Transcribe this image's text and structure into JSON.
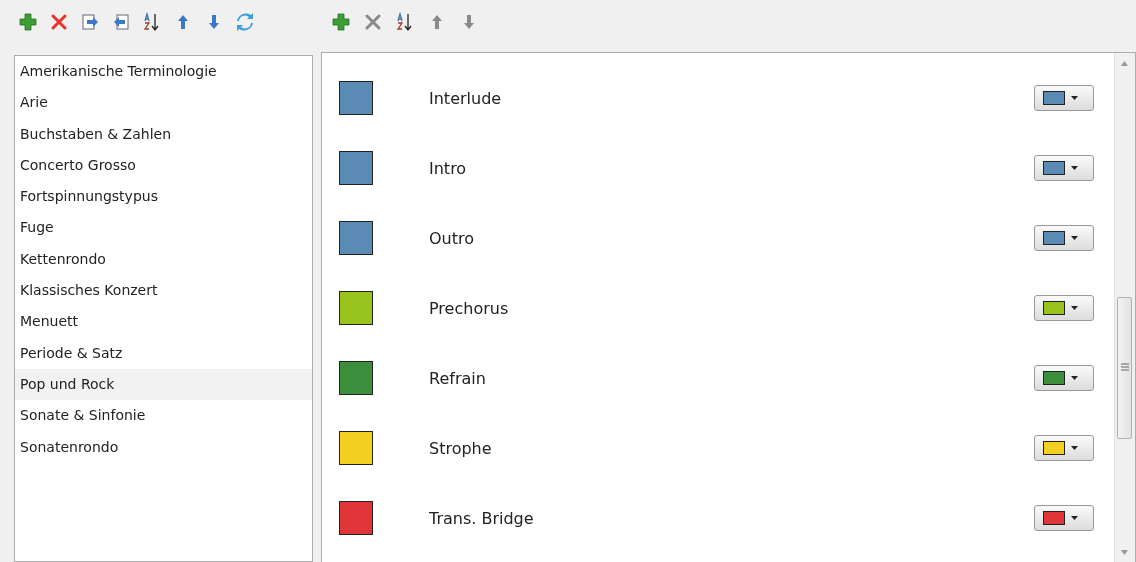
{
  "left_toolbar": [
    {
      "kind": "add",
      "disabled": false
    },
    {
      "kind": "delete",
      "disabled": false
    },
    {
      "kind": "export",
      "disabled": false
    },
    {
      "kind": "import",
      "disabled": false
    },
    {
      "kind": "sort",
      "disabled": false
    },
    {
      "kind": "up",
      "disabled": false
    },
    {
      "kind": "down",
      "disabled": false
    },
    {
      "kind": "refresh",
      "disabled": false
    }
  ],
  "right_toolbar": [
    {
      "kind": "add",
      "disabled": false
    },
    {
      "kind": "delete",
      "disabled": true
    },
    {
      "kind": "sort",
      "disabled": false
    },
    {
      "kind": "up",
      "disabled": true
    },
    {
      "kind": "down",
      "disabled": true
    }
  ],
  "templates": [
    {
      "label": "Amerikanische Terminologie",
      "selected": false
    },
    {
      "label": "Arie",
      "selected": false
    },
    {
      "label": "Buchstaben & Zahlen",
      "selected": false
    },
    {
      "label": "Concerto Grosso",
      "selected": false
    },
    {
      "label": "Fortspinnungstypus",
      "selected": false
    },
    {
      "label": "Fuge",
      "selected": false
    },
    {
      "label": "Kettenrondo",
      "selected": false
    },
    {
      "label": "Klassisches Konzert",
      "selected": false
    },
    {
      "label": "Menuett",
      "selected": false
    },
    {
      "label": "Periode & Satz",
      "selected": false
    },
    {
      "label": "Pop und Rock",
      "selected": true
    },
    {
      "label": "Sonate & Sinfonie",
      "selected": false
    },
    {
      "label": "Sonatenrondo",
      "selected": false
    }
  ],
  "sections": [
    {
      "label": "Interlude",
      "color": "#5b8bb5"
    },
    {
      "label": "Intro",
      "color": "#5b8bb5"
    },
    {
      "label": "Outro",
      "color": "#5b8bb5"
    },
    {
      "label": "Prechorus",
      "color": "#98c21c"
    },
    {
      "label": "Refrain",
      "color": "#3b8e3b"
    },
    {
      "label": "Strophe",
      "color": "#f3cf22"
    },
    {
      "label": "Trans. Bridge",
      "color": "#e0363a"
    }
  ]
}
